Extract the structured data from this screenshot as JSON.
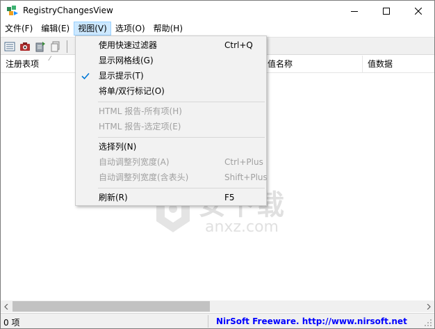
{
  "window": {
    "title": "RegistryChangesView"
  },
  "menubar": {
    "items": [
      {
        "label": "文件(F)"
      },
      {
        "label": "编辑(E)"
      },
      {
        "label": "视图(V)",
        "active": true
      },
      {
        "label": "选项(O)"
      },
      {
        "label": "帮助(H)"
      }
    ]
  },
  "toolbar": {
    "icons": [
      "list-icon",
      "snapshot-icon",
      "export-icon",
      "copy-icon"
    ]
  },
  "list": {
    "columns": [
      {
        "label": "注册表项"
      },
      {
        "label": "值名称"
      },
      {
        "label": "值数据"
      }
    ]
  },
  "view_menu": {
    "items": [
      {
        "label": "使用快速过滤器",
        "shortcut": "Ctrl+Q",
        "enabled": true,
        "checked": false
      },
      {
        "label": "显示网格线(G)",
        "shortcut": "",
        "enabled": true,
        "checked": false
      },
      {
        "label": "显示提示(T)",
        "shortcut": "",
        "enabled": true,
        "checked": true
      },
      {
        "label": "将单/双行标记(O)",
        "shortcut": "",
        "enabled": true,
        "checked": false
      },
      {
        "label": "HTML 报告-所有项(H)",
        "shortcut": "",
        "enabled": false,
        "checked": false
      },
      {
        "label": "HTML 报告-选定项(E)",
        "shortcut": "",
        "enabled": false,
        "checked": false
      },
      {
        "label": "选择列(N)",
        "shortcut": "",
        "enabled": true,
        "checked": false
      },
      {
        "label": "自动调整列宽度(A)",
        "shortcut": "Ctrl+Plus",
        "enabled": false,
        "checked": false
      },
      {
        "label": "自动调整列宽度(含表头)",
        "shortcut": "Shift+Plus",
        "enabled": false,
        "checked": false
      },
      {
        "label": "刷新(R)",
        "shortcut": "F5",
        "enabled": true,
        "checked": false
      }
    ]
  },
  "watermark": {
    "text": "安下载",
    "subtext": "anxz.com"
  },
  "status": {
    "count": "0 项",
    "credit": "NirSoft Freeware.  http://www.nirsoft.net"
  },
  "colors": {
    "menu_active_bg": "#cce8ff",
    "check_color": "#0078d7",
    "credit_color": "#0000ff"
  }
}
